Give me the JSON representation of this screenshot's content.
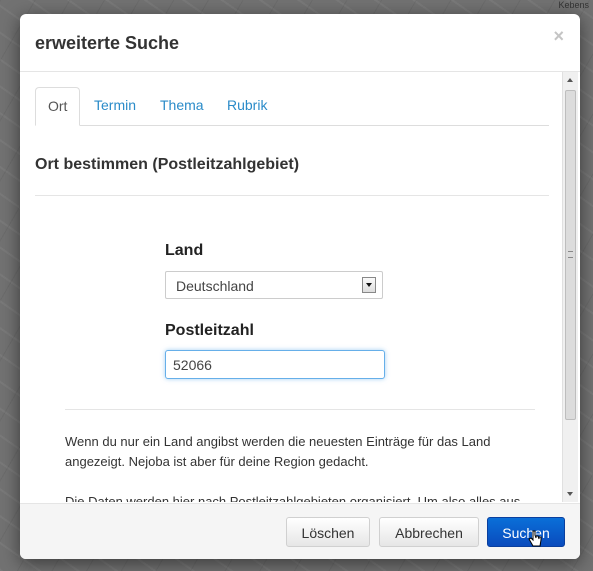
{
  "background": {
    "map_label": "Kebens"
  },
  "modal": {
    "title": "erweiterte Suche",
    "close_glyph": "×",
    "tabs": [
      {
        "label": "Ort",
        "active": true
      },
      {
        "label": "Termin",
        "active": false
      },
      {
        "label": "Thema",
        "active": false
      },
      {
        "label": "Rubrik",
        "active": false
      }
    ],
    "section_title": "Ort bestimmen (Postleitzahlgebiet)",
    "country_label": "Land",
    "country_value": "Deutschland",
    "postcode_label": "Postleitzahl",
    "postcode_value": "52066",
    "info_paragraph_1": "Wenn du nur ein Land angibst werden die neuesten Einträge für das Land angezeigt. Nejoba ist aber für deine Region gedacht.",
    "info_paragraph_2": "Die Daten werden hier nach Postleitzahlgebieten organisiert. Um also alles aus",
    "buttons": {
      "clear": "Löschen",
      "cancel": "Abbrechen",
      "search": "Suchen"
    }
  },
  "colors": {
    "link": "#2a8bc9",
    "primary": "#0a57c8",
    "focus_ring": "#66afe9"
  }
}
